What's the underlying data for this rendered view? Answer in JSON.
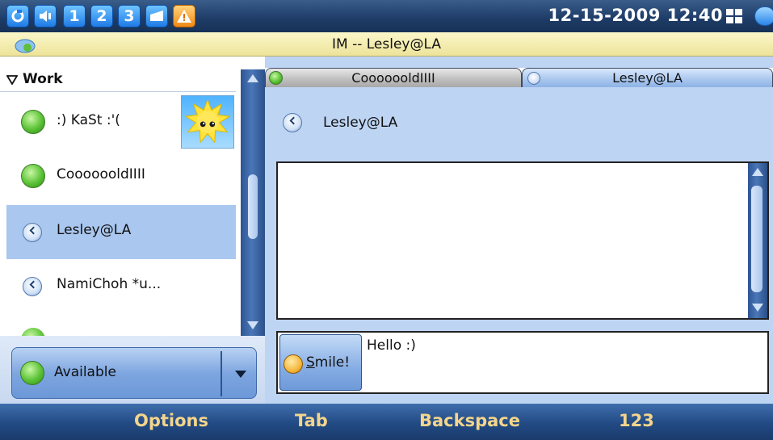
{
  "statusbar": {
    "indicators": [
      "1",
      "2",
      "3"
    ],
    "clock": "12-15-2009 12:40",
    "icons": [
      "refresh-icon",
      "volume-icon",
      "line-1-icon",
      "line-2-icon",
      "line-3-icon",
      "mail-icon",
      "alert-icon",
      "grid-icon",
      "chat-icon"
    ]
  },
  "window": {
    "title": "IM -- Lesley@LA"
  },
  "contacts": {
    "group": "Work",
    "items": [
      {
        "name": ":) KaSt :'(",
        "status": "online"
      },
      {
        "name": "CooooooldIIII",
        "status": "online"
      },
      {
        "name": "Lesley@LA",
        "status": "away",
        "selected": true
      },
      {
        "name": "NamiChoh *u...",
        "status": "away"
      }
    ]
  },
  "presence": {
    "label": "Available"
  },
  "chat": {
    "tabs": [
      {
        "label": "CooooooldIIII",
        "status": "online"
      },
      {
        "label": "Lesley@LA",
        "status": "away"
      }
    ],
    "header_name": "Lesley@LA",
    "smile_label": "Smile!",
    "message": "Hello :)"
  },
  "softkeys": [
    "Options",
    "Tab",
    "Backspace",
    "123"
  ],
  "colors": {
    "accent": "#1d3b66",
    "selected_row": "#a9c7ef",
    "panel_bg": "#bed4f3",
    "softkey_text": "#f4d58b"
  }
}
